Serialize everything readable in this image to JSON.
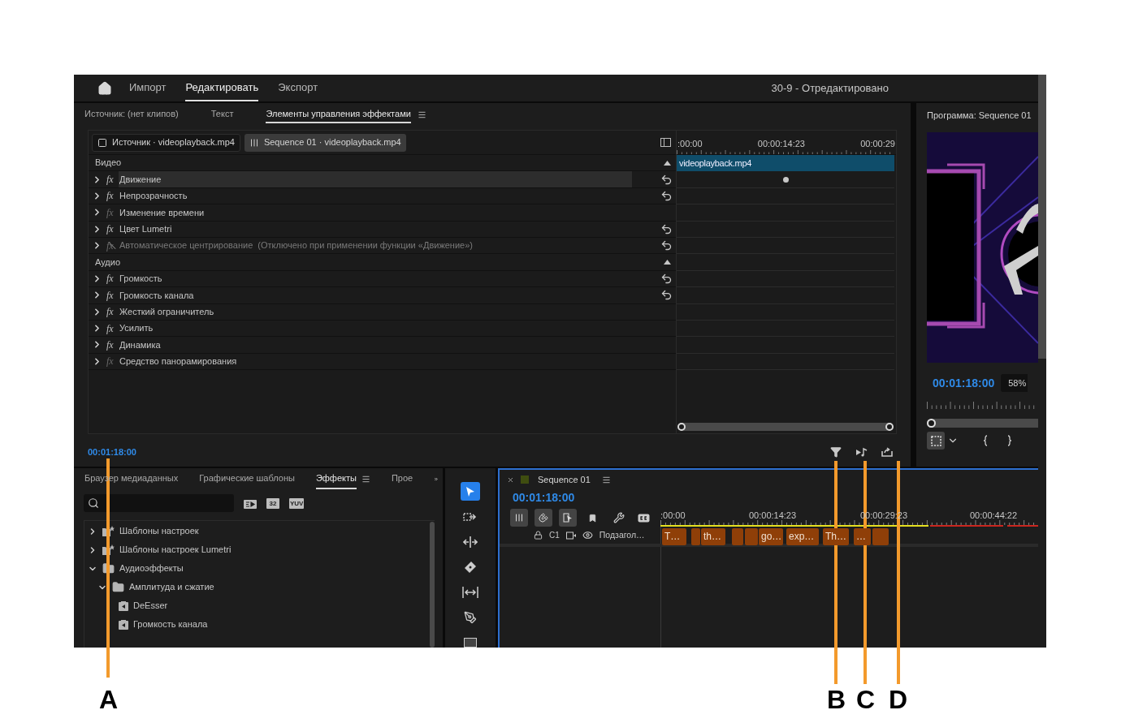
{
  "top_bar": {
    "tabs": [
      {
        "label": "Импорт",
        "selected": false
      },
      {
        "label": "Редактировать",
        "selected": true
      },
      {
        "label": "Экспорт",
        "selected": false
      }
    ],
    "title": "30-9 - Отредактировано"
  },
  "effect_controls": {
    "tabs": [
      {
        "label": "Источник: (нет клипов)",
        "selected": false
      },
      {
        "label": "Текст",
        "selected": false
      },
      {
        "label": "Элементы управления эффектами",
        "selected": true
      }
    ],
    "clip_tabs": [
      {
        "kind": "source",
        "label": "Источник · videoplayback.mp4",
        "selected": false
      },
      {
        "kind": "sequence",
        "label": "Sequence 01 · videoplayback.mp4",
        "selected": true
      }
    ],
    "rows": [
      {
        "kind": "section",
        "label": "Видео"
      },
      {
        "kind": "effect",
        "fx": "fx",
        "label": "Движение",
        "enabled": true,
        "blocked": false,
        "reset": true,
        "selected": true
      },
      {
        "kind": "effect",
        "fx": "fx",
        "label": "Непрозрачность",
        "enabled": true,
        "blocked": false,
        "reset": true,
        "selected": false
      },
      {
        "kind": "effect",
        "fx": "fx",
        "label": "Изменение времени",
        "enabled": false,
        "blocked": false,
        "reset": false,
        "selected": false
      },
      {
        "kind": "effect",
        "fx": "fx",
        "label": "Цвет Lumetri",
        "enabled": true,
        "blocked": false,
        "reset": true,
        "selected": false
      },
      {
        "kind": "effect",
        "fx": "fx",
        "label": "Автоматическое центрирование  (Отключено при применении функции «Движение»)",
        "enabled": false,
        "blocked": true,
        "reset": true,
        "selected": false
      },
      {
        "kind": "section",
        "label": "Аудио"
      },
      {
        "kind": "effect",
        "fx": "fx",
        "label": "Громкость",
        "enabled": true,
        "blocked": false,
        "reset": true,
        "selected": false
      },
      {
        "kind": "effect",
        "fx": "fx",
        "label": "Громкость канала",
        "enabled": true,
        "blocked": false,
        "reset": true,
        "selected": false
      },
      {
        "kind": "effect",
        "fx": "fx",
        "label": "Жесткий ограничитель",
        "enabled": true,
        "blocked": false,
        "reset": false,
        "selected": false
      },
      {
        "kind": "effect",
        "fx": "fx",
        "label": "Усилить",
        "enabled": true,
        "blocked": false,
        "reset": false,
        "selected": false
      },
      {
        "kind": "effect",
        "fx": "fx",
        "label": "Динамика",
        "enabled": true,
        "blocked": false,
        "reset": false,
        "selected": false
      },
      {
        "kind": "effect",
        "fx": "fx",
        "label": "Средство панорамирования",
        "enabled": false,
        "blocked": false,
        "reset": false,
        "selected": false
      }
    ],
    "ruler": [
      ":00:00",
      "00:00:14:23",
      "00:00:29"
    ],
    "clip": "videoplayback.mp4",
    "timecode": "00:01:18:00"
  },
  "program_monitor": {
    "title": "Программа: Sequence 01",
    "timecode": "00:01:18:00",
    "zoom": "58%"
  },
  "effects_panel": {
    "tabs": [
      {
        "label": "Браузер медиаданных",
        "selected": false
      },
      {
        "label": "Графические шаблоны",
        "selected": false
      },
      {
        "label": "Эффекты",
        "selected": true
      },
      {
        "label": "Прое",
        "selected": false
      }
    ],
    "badges": [
      "32",
      "YUV"
    ],
    "tree": [
      {
        "kind": "preset",
        "label": "Шаблоны настроек",
        "expanded": false
      },
      {
        "kind": "preset",
        "label": "Шаблоны настроек Lumetri",
        "expanded": false
      },
      {
        "kind": "folder",
        "label": "Аудиоэффекты",
        "expanded": true,
        "children": [
          {
            "kind": "folder",
            "label": "Амплитуда и сжатие",
            "expanded": true,
            "children": [
              {
                "kind": "effect",
                "label": "DeEsser"
              },
              {
                "kind": "effect",
                "label": "Громкость канала"
              }
            ]
          }
        ]
      }
    ]
  },
  "tools": [
    {
      "kind": "select",
      "selected": true
    },
    {
      "kind": "track-select",
      "selected": false
    },
    {
      "kind": "ripple",
      "selected": false
    },
    {
      "kind": "razor",
      "selected": false
    },
    {
      "kind": "slip",
      "selected": false
    },
    {
      "kind": "pen",
      "selected": false
    },
    {
      "kind": "rectangle",
      "selected": false
    }
  ],
  "timeline": {
    "title": "Sequence 01",
    "timecode": "00:01:18:00",
    "ruler": [
      ":00:00",
      "00:00:14:23",
      "00:00:29:23",
      "00:00:44:22"
    ],
    "track": {
      "name": "C1",
      "label": "Подзагол…"
    },
    "clips": [
      {
        "kind": "clip",
        "label": "T…"
      },
      {
        "kind": "clip"
      },
      {
        "kind": "clip",
        "label": "th…"
      },
      {
        "kind": "clip"
      },
      {
        "kind": "clip"
      },
      {
        "kind": "clip",
        "label": "go…"
      },
      {
        "kind": "clip",
        "label": "exp…"
      },
      {
        "kind": "clip",
        "label": "Th…"
      },
      {
        "kind": "clip",
        "label": "…"
      },
      {
        "kind": "clip"
      }
    ]
  },
  "callouts": [
    {
      "label": "A"
    },
    {
      "label": "B"
    },
    {
      "label": "C"
    },
    {
      "label": "D"
    }
  ]
}
